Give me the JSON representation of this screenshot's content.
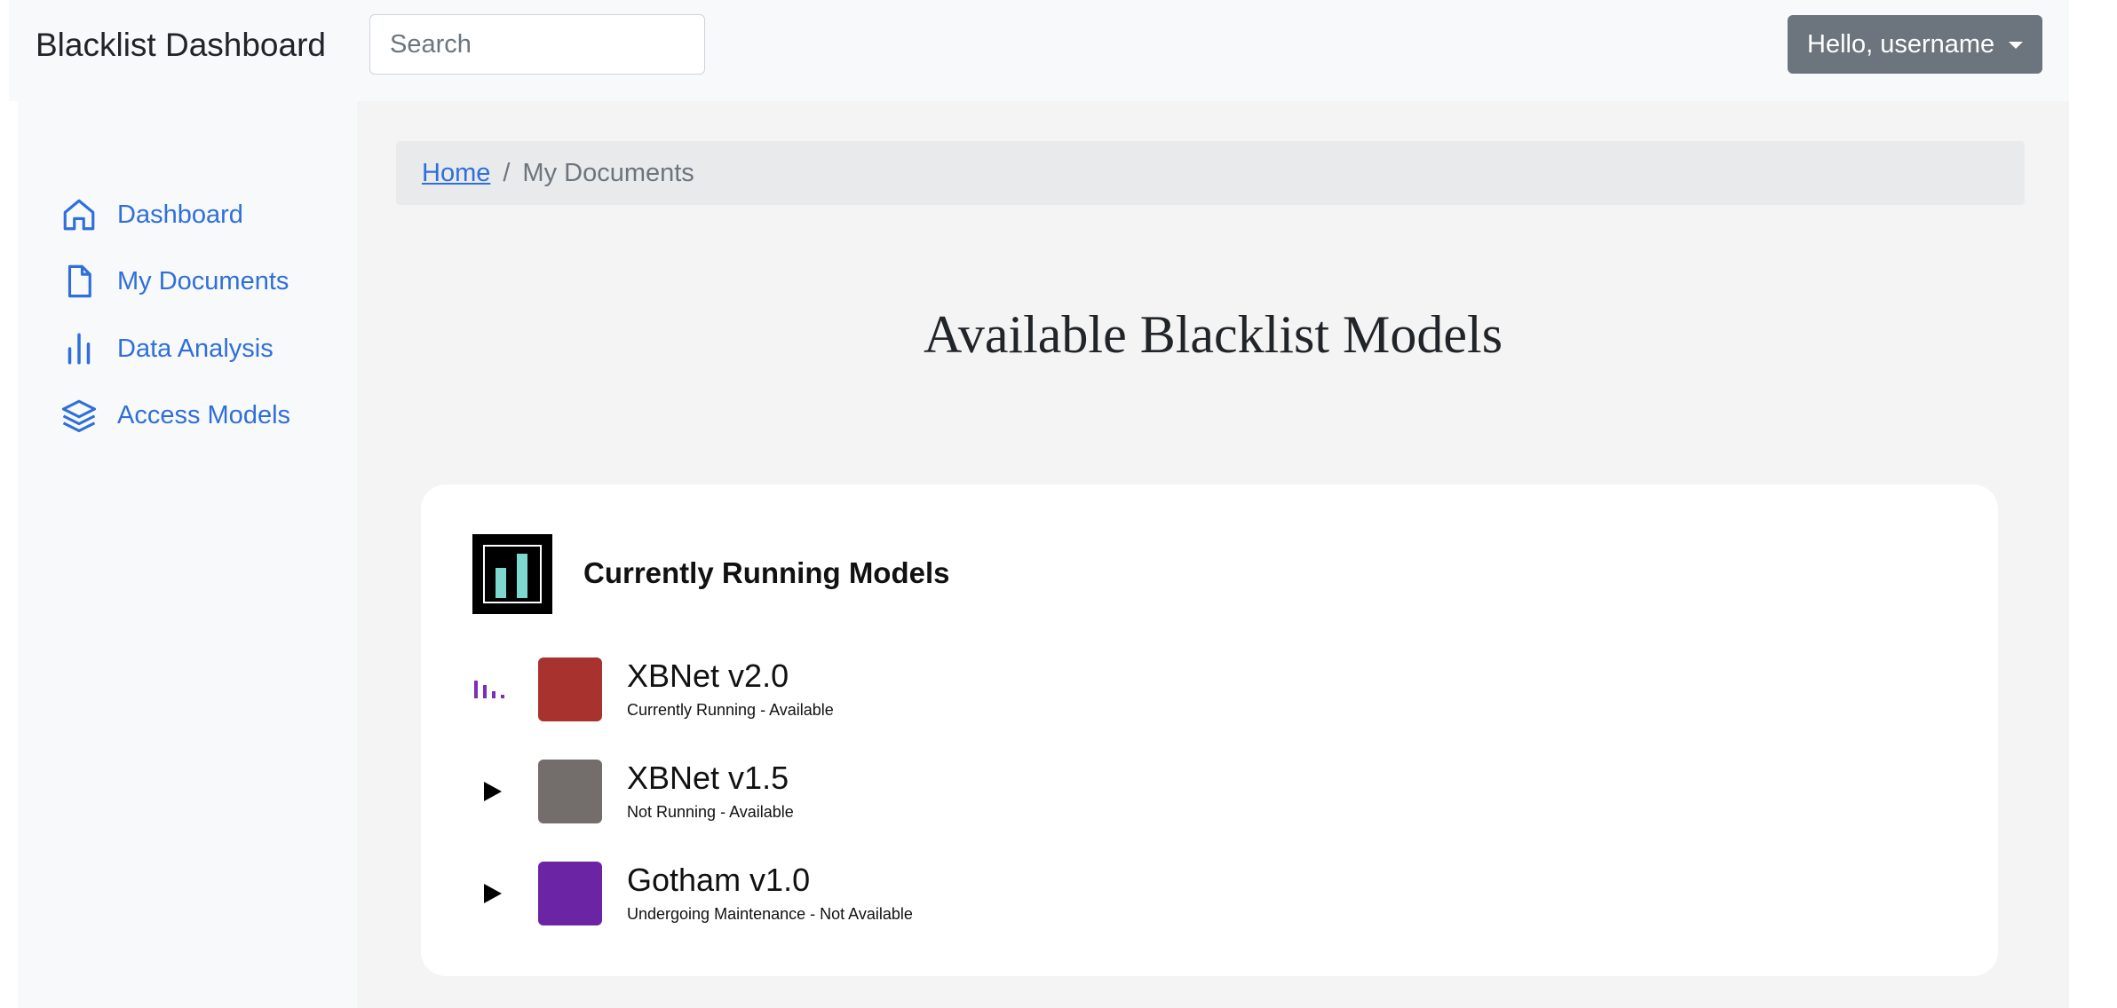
{
  "navbar": {
    "brand": "Blacklist Dashboard",
    "search_placeholder": "Search",
    "user_menu_label": "Hello, username"
  },
  "sidebar": {
    "items": [
      {
        "label": "Dashboard",
        "icon": "house-icon"
      },
      {
        "label": "My Documents",
        "icon": "file-icon"
      },
      {
        "label": "Data Analysis",
        "icon": "bar-chart-icon"
      },
      {
        "label": "Access Models",
        "icon": "layers-icon"
      }
    ]
  },
  "breadcrumb": {
    "home": "Home",
    "separator": "/",
    "current": "My Documents"
  },
  "main": {
    "title": "Available Blacklist Models"
  },
  "card": {
    "title": "Currently Running Models",
    "models": [
      {
        "name": "XBNet v2.0",
        "status": "Currently Running - Available",
        "color": "#a8322d",
        "action_icon": "running-bars-icon"
      },
      {
        "name": "XBNet v1.5",
        "status": "Not Running - Available",
        "color": "#736d6c",
        "action_icon": "play-icon"
      },
      {
        "name": "Gotham v1.0",
        "status": "Undergoing Maintenance - Not Available",
        "color": "#6b24a3",
        "action_icon": "play-icon"
      }
    ]
  },
  "colors": {
    "accent": "#2f6fdb",
    "running_indicator": "#7b2fb8",
    "user_button": "#6c757d",
    "logo_bars": "#7ed8d0"
  }
}
